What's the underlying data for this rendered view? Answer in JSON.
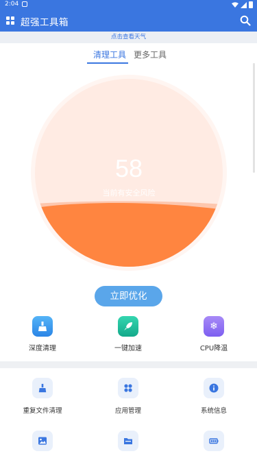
{
  "status_bar": {
    "time": "2:04"
  },
  "app_bar": {
    "title": "超强工具箱"
  },
  "weather_bar": {
    "label": "点击查看天气"
  },
  "tabs": [
    {
      "label": "清理工具",
      "active": true
    },
    {
      "label": "更多工具",
      "active": false
    }
  ],
  "gauge": {
    "score": "58",
    "label": "当前有安全风险",
    "fill_fraction": 0.34,
    "fill_color": "#ff8540",
    "bg_color": "#ffebe3"
  },
  "optimize_button": {
    "label": "立即优化"
  },
  "quick_actions": [
    {
      "label": "深度清理",
      "icon": "broom-icon"
    },
    {
      "label": "一键加速",
      "icon": "rocket-icon"
    },
    {
      "label": "CPU降温",
      "icon": "snowflake-icon"
    }
  ],
  "tools": [
    {
      "label": "重复文件清理",
      "icon": "broom-icon"
    },
    {
      "label": "应用管理",
      "icon": "apps-icon"
    },
    {
      "label": "系统信息",
      "icon": "info-icon"
    },
    {
      "label": "",
      "icon": "image-icon"
    },
    {
      "label": "",
      "icon": "folder-icon"
    },
    {
      "label": "",
      "icon": "battery-icon"
    }
  ],
  "colors": {
    "accent": "#3a76e0",
    "button": "#5aa6ea"
  }
}
